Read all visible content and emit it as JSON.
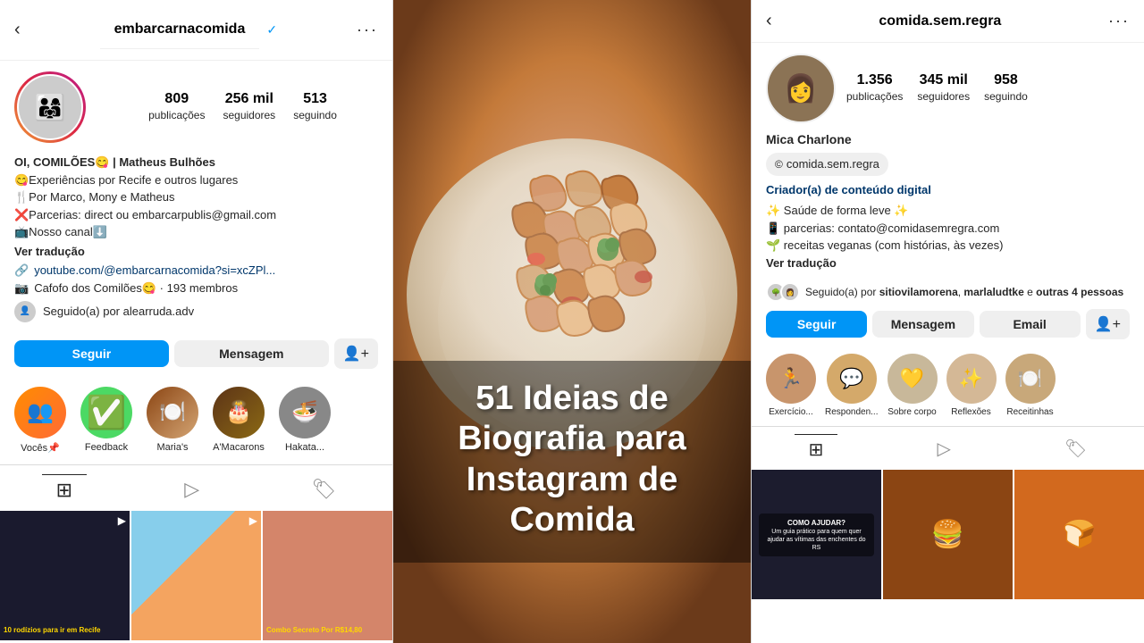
{
  "left": {
    "header": {
      "username": "embarcarnacomida",
      "verified": "✓",
      "more": "···",
      "back": "‹"
    },
    "stats": {
      "posts_num": "809",
      "posts_label": "publicações",
      "followers_num": "256 mil",
      "followers_label": "seguidores",
      "following_num": "513",
      "following_label": "seguindo"
    },
    "bio": {
      "line1": "OI, COMILÕES😋 | Matheus Bulhões",
      "line2": "😋Experiências por Recife e outros lugares",
      "line3": "🍴Por Marco, Mony e Matheus",
      "line4": "❌Parcerias: direct ou embarcarpublis@gmail.com",
      "line5": "📺Nosso canal⬇️",
      "ver_traducao": "Ver tradução",
      "link": "youtube.com/@embarcarnacomida?si=xcZPl...",
      "group": "Cafofo dos Comilões😋 · 193 membros",
      "following_by": "Seguido(a) por alearruda.adv"
    },
    "buttons": {
      "seguir": "Seguir",
      "mensagem": "Mensagem"
    },
    "stories": [
      {
        "label": "Vocês📌",
        "emoji": "👥"
      },
      {
        "label": "Feedback",
        "emoji": "✅"
      },
      {
        "label": "Maria's",
        "emoji": "🍽️"
      },
      {
        "label": "A'Macarons",
        "emoji": "🎂"
      },
      {
        "label": "Hakata...",
        "emoji": "🍜"
      }
    ],
    "posts": [
      {
        "label": "10 rodízios para ir em Recife",
        "type": "video",
        "bg": "dark"
      },
      {
        "label": "",
        "type": "image",
        "bg": "beach"
      },
      {
        "label": "Combo Secreto Por R$14,80",
        "type": "image",
        "bg": "food2"
      }
    ]
  },
  "center": {
    "title": "51 Ideias de Biografia para Instagram de Comida"
  },
  "right": {
    "header": {
      "username": "comida.sem.regra",
      "more": "···",
      "back": "‹"
    },
    "stats": {
      "posts_num": "1.356",
      "posts_label": "publicações",
      "followers_num": "345 mil",
      "followers_label": "seguidores",
      "following_num": "958",
      "following_label": "seguindo"
    },
    "name": "Mica Charlone",
    "tag": "comida.sem.regra",
    "bio": {
      "creator_label": "Criador(a) de conteúdo digital",
      "line1": "✨ Saúde de forma leve ✨",
      "line2": "📱 parcerias: contato@comidasemregra.com",
      "line3": "🌱 receitas veganas (com histórias, às vezes)",
      "ver_traducao": "Ver tradução"
    },
    "following_by": "Seguido(a) por sitiovilamorena, marlaludtke e outras 4 pessoas",
    "buttons": {
      "seguir": "Seguir",
      "mensagem": "Mensagem",
      "email": "Email"
    },
    "stories": [
      {
        "label": "Exercício...",
        "emoji": "🏃"
      },
      {
        "label": "Responden...",
        "emoji": "💬"
      },
      {
        "label": "Sobre corpo",
        "emoji": "💛"
      },
      {
        "label": "Reflexões",
        "emoji": "✨"
      },
      {
        "label": "Receitinhas",
        "emoji": "🍽️"
      }
    ],
    "posts": [
      {
        "label": "COMO AJUDAR?",
        "type": "image",
        "bg": "dark"
      },
      {
        "label": "",
        "type": "image",
        "bg": "burger"
      },
      {
        "label": "",
        "type": "image",
        "bg": "bread"
      }
    ]
  }
}
